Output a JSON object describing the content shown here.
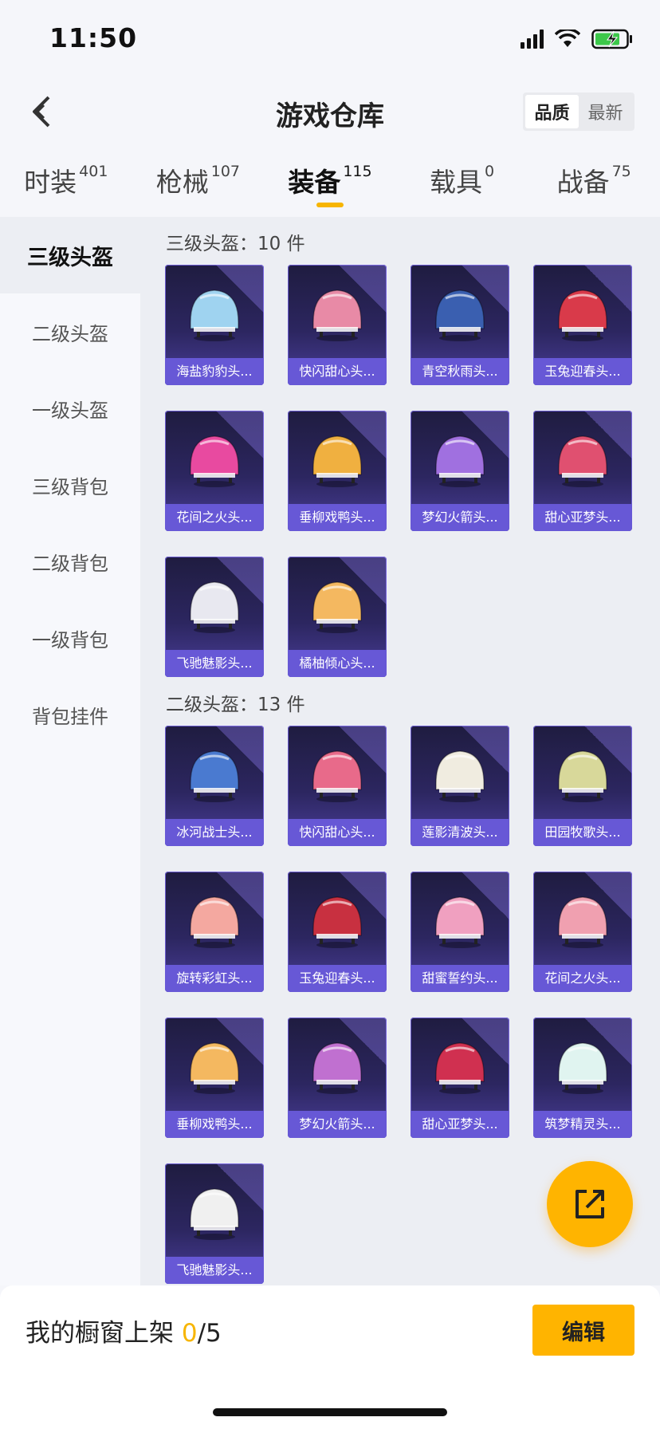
{
  "status_bar": {
    "time": "11:50"
  },
  "header": {
    "title": "游戏仓库",
    "sort_quality": "品质",
    "sort_latest": "最新"
  },
  "tabs": [
    {
      "label": "时装",
      "count": "401",
      "active": false
    },
    {
      "label": "枪械",
      "count": "107",
      "active": false
    },
    {
      "label": "装备",
      "count": "115",
      "active": true
    },
    {
      "label": "载具",
      "count": "0",
      "active": false
    },
    {
      "label": "战备",
      "count": "75",
      "active": false
    }
  ],
  "sidebar": {
    "items": [
      {
        "label": "三级头盔",
        "active": true
      },
      {
        "label": "二级头盔",
        "active": false
      },
      {
        "label": "一级头盔",
        "active": false
      },
      {
        "label": "三级背包",
        "active": false
      },
      {
        "label": "二级背包",
        "active": false
      },
      {
        "label": "一级背包",
        "active": false
      },
      {
        "label": "背包挂件",
        "active": false
      }
    ]
  },
  "sections": [
    {
      "title": "三级头盔：10 件",
      "items": [
        {
          "label": "海盐豹豹头...",
          "color": "#9fd3f0"
        },
        {
          "label": "快闪甜心头...",
          "color": "#e88aa6"
        },
        {
          "label": "青空秋雨头...",
          "color": "#3a5fb0"
        },
        {
          "label": "玉兔迎春头...",
          "color": "#d93a4a"
        },
        {
          "label": "花间之火头...",
          "color": "#e84aa0"
        },
        {
          "label": "垂柳戏鸭头...",
          "color": "#f0b040"
        },
        {
          "label": "梦幻火箭头...",
          "color": "#a070e0"
        },
        {
          "label": "甜心亚梦头...",
          "color": "#e05070"
        },
        {
          "label": "飞驰魅影头...",
          "color": "#e8e8f0"
        },
        {
          "label": "橘柚倾心头...",
          "color": "#f4b860"
        }
      ]
    },
    {
      "title": "二级头盔：13 件",
      "items": [
        {
          "label": "冰河战士头...",
          "color": "#4a7ad0"
        },
        {
          "label": "快闪甜心头...",
          "color": "#e86a8a"
        },
        {
          "label": "莲影清波头...",
          "color": "#f0ece0"
        },
        {
          "label": "田园牧歌头...",
          "color": "#d8d89a"
        },
        {
          "label": "旋转彩虹头...",
          "color": "#f4a8a0"
        },
        {
          "label": "玉兔迎春头...",
          "color": "#c83040"
        },
        {
          "label": "甜蜜誓约头...",
          "color": "#f0a0c0"
        },
        {
          "label": "花间之火头...",
          "color": "#f0a0b0"
        },
        {
          "label": "垂柳戏鸭头...",
          "color": "#f4b860"
        },
        {
          "label": "梦幻火箭头...",
          "color": "#c070d0"
        },
        {
          "label": "甜心亚梦头...",
          "color": "#d03050"
        },
        {
          "label": "筑梦精灵头...",
          "color": "#e0f4f0"
        },
        {
          "label": "飞驰魅影头...",
          "color": "#f0f0f0"
        }
      ]
    }
  ],
  "bottom": {
    "showcase_label": "我的橱窗上架",
    "count": "0",
    "total": "/5",
    "edit": "编辑"
  },
  "colors": {
    "accent": "#ffb400",
    "card_label": "#6758d6"
  }
}
